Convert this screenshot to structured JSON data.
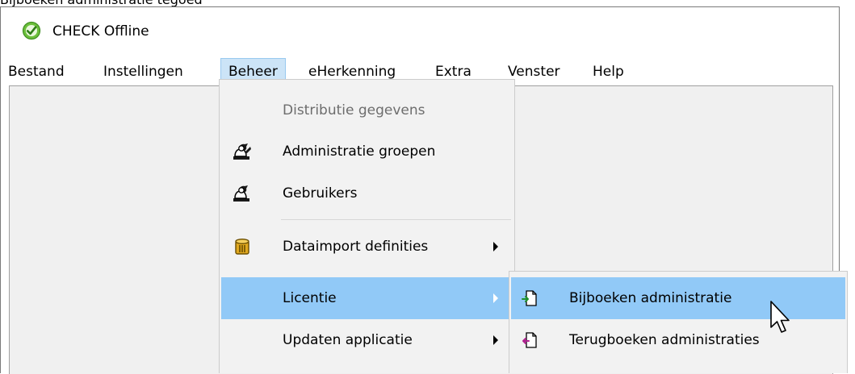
{
  "caption": "Bijboeken administratie tegoed",
  "window": {
    "title": "CHECK Offline",
    "app_icon": "green-check-circle-icon"
  },
  "menubar": {
    "items": [
      {
        "label": "Bestand"
      },
      {
        "label": "Instellingen"
      },
      {
        "label": "Beheer",
        "active": true
      },
      {
        "label": "eHerkenning"
      },
      {
        "label": "Extra"
      },
      {
        "label": "Venster"
      },
      {
        "label": "Help"
      }
    ]
  },
  "beheer_menu": {
    "items": [
      {
        "label": "Distributie gegevens",
        "enabled": false
      },
      {
        "label": "Administratie groepen",
        "icon": "user-group-icon"
      },
      {
        "label": "Gebruikers",
        "icon": "user-icon"
      },
      {
        "label": "Dataimport definities",
        "icon": "database-icon",
        "submenu": true
      },
      {
        "label": "Licentie",
        "submenu": true,
        "highlighted": true
      },
      {
        "label": "Updaten applicatie",
        "submenu": true
      }
    ]
  },
  "licentie_submenu": {
    "items": [
      {
        "label": "Bijboeken administratie",
        "icon": "document-add-icon",
        "highlighted": true
      },
      {
        "label": "Terugboeken administraties",
        "icon": "document-return-icon"
      }
    ]
  },
  "colors": {
    "menu_highlight": "#91c9f7",
    "menubar_active": "#cce4f7",
    "menu_background": "#f2f2f2",
    "client_background": "#f0f0f0"
  }
}
